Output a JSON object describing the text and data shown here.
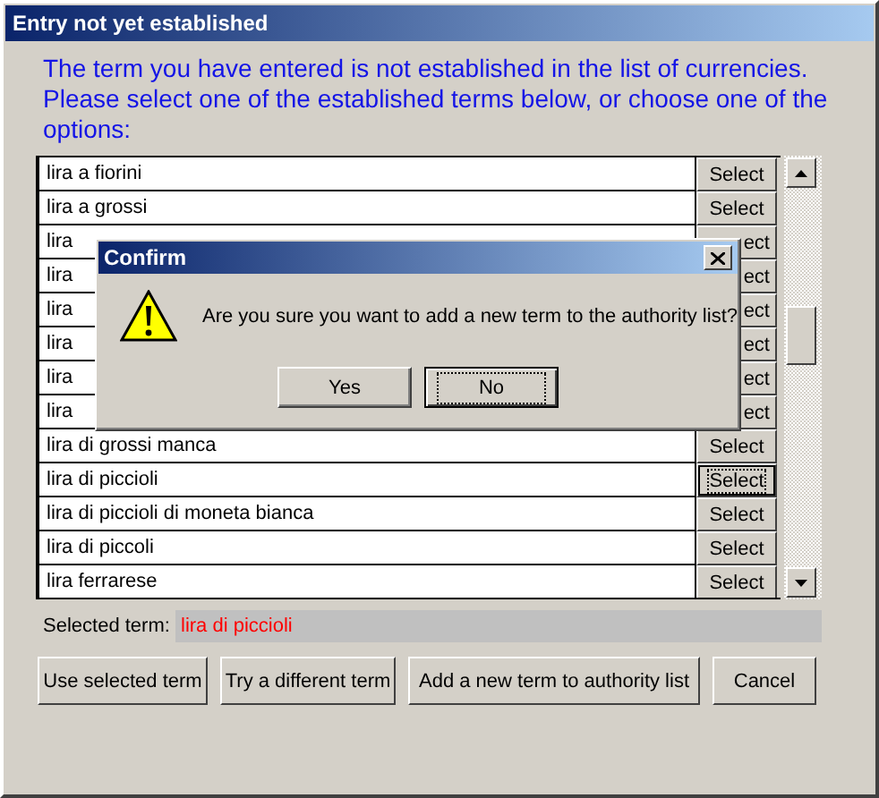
{
  "window": {
    "title": "Entry not yet established"
  },
  "message": "The term you have entered is not established in the list of currencies. Please select one of the established terms below, or choose one of the options:",
  "terms": [
    {
      "label": "lira a fiorini",
      "button": "Select",
      "covered": false,
      "focused": false
    },
    {
      "label": "lira a grossi",
      "button": "Select",
      "covered": false,
      "focused": false
    },
    {
      "label": "lira",
      "button": "ect",
      "covered": true,
      "focused": false
    },
    {
      "label": "lira",
      "button": "ect",
      "covered": true,
      "focused": false
    },
    {
      "label": "lira",
      "button": "ect",
      "covered": true,
      "focused": false
    },
    {
      "label": "lira",
      "button": "ect",
      "covered": true,
      "focused": false
    },
    {
      "label": "lira",
      "button": "ect",
      "covered": true,
      "focused": false
    },
    {
      "label": "lira",
      "button": "ect",
      "covered": true,
      "focused": false
    },
    {
      "label": "lira di grossi manca",
      "button": "Select",
      "covered": false,
      "focused": false
    },
    {
      "label": "lira di piccioli",
      "button": "Select",
      "covered": false,
      "focused": true
    },
    {
      "label": "lira di piccioli di moneta bianca",
      "button": "Select",
      "covered": false,
      "focused": false
    },
    {
      "label": "lira di piccoli",
      "button": "Select",
      "covered": false,
      "focused": false
    },
    {
      "label": "lira ferrarese",
      "button": "Select",
      "covered": false,
      "focused": false
    }
  ],
  "selected_term": {
    "label": "Selected term:",
    "value": "lira di piccioli"
  },
  "buttons": [
    "Use selected term",
    "Try a different term",
    "Add a new term to authority list",
    "Cancel"
  ],
  "dialog": {
    "title": "Confirm",
    "message": "Are you sure you want to add a new term to the authority list?",
    "buttons": [
      {
        "label": "Yes",
        "focused": false
      },
      {
        "label": "No",
        "focused": true
      }
    ]
  }
}
